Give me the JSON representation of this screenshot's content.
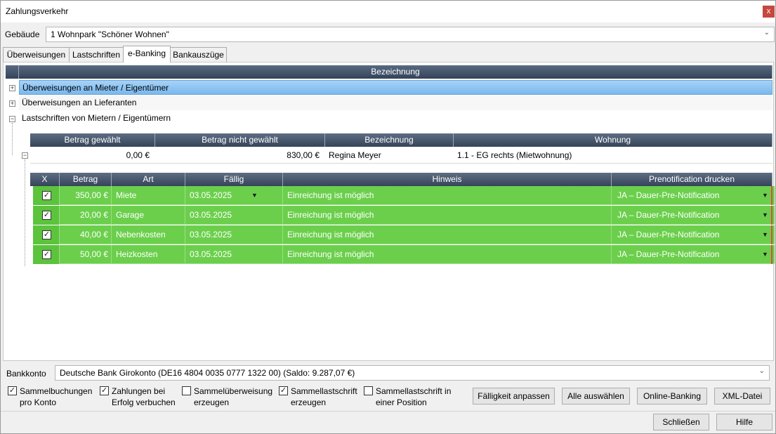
{
  "window": {
    "title": "Zahlungsverkehr",
    "close_label": "x"
  },
  "building": {
    "label": "Gebäude",
    "value": "1 Wohnpark \"Schöner Wohnen\""
  },
  "tabs": [
    "Überweisungen",
    "Lastschriften",
    "e-Banking",
    "Bankauszüge"
  ],
  "grid": {
    "header": "Bezeichnung",
    "groups": [
      {
        "label": "Überweisungen an Mieter / Eigentümer",
        "expander": "+"
      },
      {
        "label": "Überweisungen an Lieferanten",
        "expander": "+"
      },
      {
        "label": "Lastschriften von Mietern / Eigentümern",
        "expander": "−"
      }
    ],
    "sub_headers": [
      "Betrag gewählt",
      "Betrag nicht gewählt",
      "Bezeichnung",
      "Wohnung"
    ],
    "tenant_row": {
      "expander": "−",
      "amount_selected": "0,00 €",
      "amount_not_selected": "830,00 €",
      "name": "Regina Meyer",
      "apartment": "1.1 - EG rechts (Mietwohnung)"
    },
    "detail_headers": [
      "X",
      "Betrag",
      "Art",
      "Fällig",
      "Hinweis",
      "Prenotification drucken"
    ],
    "detail_rows": [
      {
        "checked": "✓",
        "amount": "350,00 €",
        "type": "Miete",
        "due": "03.05.2025",
        "note": "Einreichung ist möglich",
        "prenotification": "JA – Dauer-Pre-Notification"
      },
      {
        "checked": "✓",
        "amount": "20,00 €",
        "type": "Garage",
        "due": "03.05.2025",
        "note": "Einreichung ist möglich",
        "prenotification": "JA – Dauer-Pre-Notification"
      },
      {
        "checked": "✓",
        "amount": "40,00 €",
        "type": "Nebenkosten",
        "due": "03.05.2025",
        "note": "Einreichung ist möglich",
        "prenotification": "JA – Dauer-Pre-Notification"
      },
      {
        "checked": "✓",
        "amount": "50,00 €",
        "type": "Heizkosten",
        "due": "03.05.2025",
        "note": "Einreichung ist möglich",
        "prenotification": "JA – Dauer-Pre-Notification"
      }
    ]
  },
  "bank_account": {
    "label": "Bankkonto",
    "value": "Deutsche Bank Girokonto (DE16 4804 0035 0777 1322 00) (Saldo: 9.287,07 €)"
  },
  "options": [
    {
      "line1": "Sammelbuchungen",
      "line2": "pro Konto",
      "checked": true
    },
    {
      "line1": "Zahlungen bei",
      "line2": "Erfolg verbuchen",
      "checked": true
    },
    {
      "line1": "Sammelüberweisung",
      "line2": "erzeugen",
      "checked": false
    },
    {
      "line1": "Sammellastschrift",
      "line2": "erzeugen",
      "checked": true
    },
    {
      "line1": "Sammellastschrift in",
      "line2": "einer Position",
      "checked": false
    }
  ],
  "buttons": {
    "adjust_due": "Fälligkeit anpassen",
    "select_all": "Alle auswählen",
    "online_banking": "Online-Banking",
    "xml_file": "XML-Datei",
    "close": "Schließen",
    "help": "Hilfe"
  },
  "check_glyph": "✓",
  "colors": {
    "row_green": "#6bcf4c",
    "header_dark": "#3f4e63",
    "selection_blue": "#8cc5f3"
  }
}
